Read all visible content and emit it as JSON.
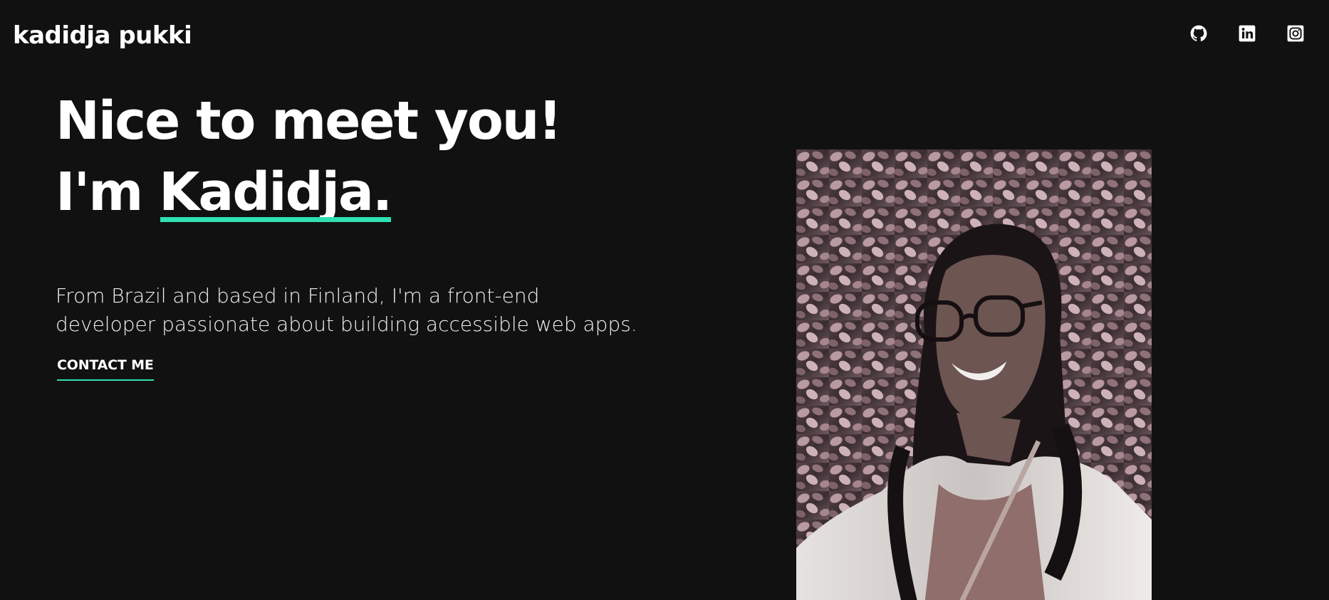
{
  "brand": {
    "name": "kadidja pukki"
  },
  "social": [
    {
      "name": "github",
      "icon": "github-icon"
    },
    {
      "name": "linkedin",
      "icon": "linkedin-icon"
    },
    {
      "name": "instagram",
      "icon": "instagram-icon"
    }
  ],
  "hero": {
    "headline_line1": "Nice to meet you!",
    "headline_prefix": "I'm ",
    "headline_name": "Kadidja.",
    "intro": "From Brazil and based in Finland, I'm a front-end developer passionate about building accessible web apps.",
    "cta_label": "CONTACT ME"
  },
  "colors": {
    "background": "#111111",
    "text": "#ffffff",
    "accent": "#2ee0b3"
  }
}
